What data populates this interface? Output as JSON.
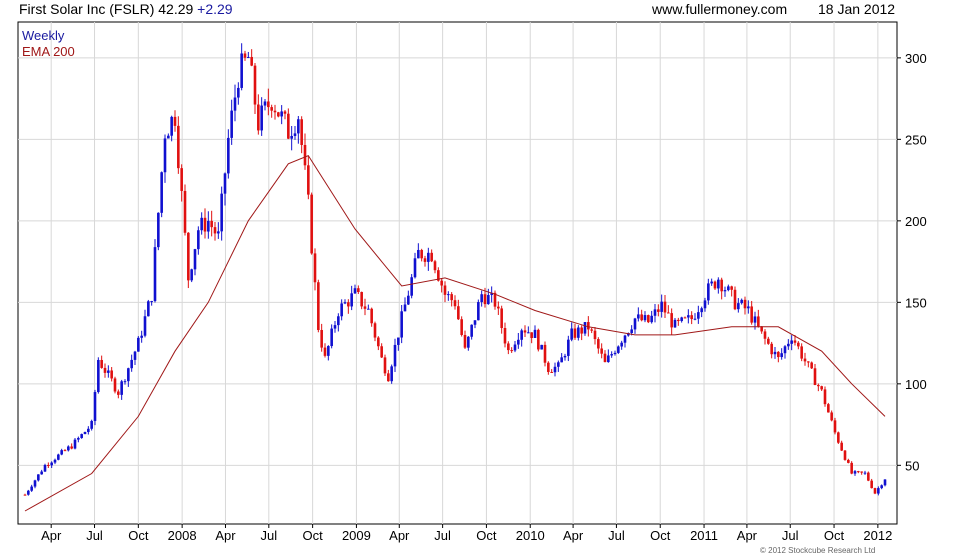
{
  "header": {
    "title": "First Solar Inc (FSLR) 42.29",
    "change": "+2.29",
    "source": "www.fullermoney.com",
    "date": "18 Jan 2012"
  },
  "copyright": "© 2012 Stockcube Research Ltd",
  "colors": {
    "up": "#1010d0",
    "down": "#e01010",
    "ema": "#a01818",
    "grid": "#d8d8d8",
    "legend_weekly": "#1a1aa0",
    "legend_ema": "#a01818"
  },
  "chart_data": {
    "type": "candlestick",
    "legend": [
      "Weekly",
      "EMA 200"
    ],
    "x_ticks": [
      "Apr",
      "Jul",
      "Oct",
      "2008",
      "Apr",
      "Jul",
      "Oct",
      "2009",
      "Apr",
      "Jul",
      "Oct",
      "2010",
      "Apr",
      "Jul",
      "Oct",
      "2011",
      "Apr",
      "Jul",
      "Oct",
      "2012"
    ],
    "y_ticks": [
      50,
      100,
      150,
      200,
      250,
      300
    ],
    "ylim": [
      14,
      322
    ],
    "grid": true,
    "y_axis_side": "right",
    "date_range": [
      "2007-02-05",
      "2012-01-16"
    ],
    "price_path": [
      [
        "2007-02-05",
        32
      ],
      [
        "2007-03-19",
        50
      ],
      [
        "2007-05-14",
        62
      ],
      [
        "2007-06-25",
        75
      ],
      [
        "2007-07-09",
        115
      ],
      [
        "2007-08-20",
        95
      ],
      [
        "2007-10-01",
        125
      ],
      [
        "2007-10-29",
        155
      ],
      [
        "2007-11-26",
        255
      ],
      [
        "2007-12-17",
        265
      ],
      [
        "2008-01-14",
        165
      ],
      [
        "2008-02-04",
        195
      ],
      [
        "2008-02-25",
        200
      ],
      [
        "2008-03-17",
        190
      ],
      [
        "2008-04-07",
        250
      ],
      [
        "2008-04-28",
        290
      ],
      [
        "2008-05-19",
        300
      ],
      [
        "2008-06-09",
        260
      ],
      [
        "2008-07-07",
        275
      ],
      [
        "2008-08-11",
        255
      ],
      [
        "2008-09-01",
        265
      ],
      [
        "2008-09-22",
        210
      ],
      [
        "2008-10-13",
        135
      ],
      [
        "2008-10-27",
        115
      ],
      [
        "2008-11-24",
        145
      ],
      [
        "2008-12-29",
        155
      ],
      [
        "2009-01-26",
        145
      ],
      [
        "2009-02-23",
        115
      ],
      [
        "2009-03-09",
        105
      ],
      [
        "2009-04-06",
        140
      ],
      [
        "2009-05-11",
        180
      ],
      [
        "2009-06-08",
        180
      ],
      [
        "2009-07-06",
        155
      ],
      [
        "2009-07-27",
        150
      ],
      [
        "2009-08-17",
        120
      ],
      [
        "2009-09-21",
        155
      ],
      [
        "2009-10-19",
        150
      ],
      [
        "2009-11-16",
        120
      ],
      [
        "2009-12-14",
        135
      ],
      [
        "2010-01-11",
        130
      ],
      [
        "2010-02-08",
        110
      ],
      [
        "2010-03-01",
        110
      ],
      [
        "2010-03-29",
        130
      ],
      [
        "2010-05-03",
        135
      ],
      [
        "2010-06-07",
        112
      ],
      [
        "2010-07-05",
        125
      ],
      [
        "2010-08-09",
        140
      ],
      [
        "2010-09-06",
        138
      ],
      [
        "2010-10-04",
        148
      ],
      [
        "2010-11-01",
        135
      ],
      [
        "2010-12-06",
        140
      ],
      [
        "2011-01-03",
        155
      ],
      [
        "2011-01-31",
        165
      ],
      [
        "2011-03-07",
        150
      ],
      [
        "2011-04-04",
        145
      ],
      [
        "2011-05-02",
        130
      ],
      [
        "2011-06-06",
        115
      ],
      [
        "2011-07-04",
        130
      ],
      [
        "2011-08-08",
        110
      ],
      [
        "2011-09-05",
        95
      ],
      [
        "2011-10-03",
        70
      ],
      [
        "2011-11-07",
        45
      ],
      [
        "2011-12-05",
        45
      ],
      [
        "2011-12-26",
        33
      ],
      [
        "2012-01-16",
        42
      ]
    ],
    "ema_path": [
      [
        "2007-02-05",
        22
      ],
      [
        "2007-06-25",
        45
      ],
      [
        "2007-10-01",
        80
      ],
      [
        "2007-12-17",
        120
      ],
      [
        "2008-02-25",
        150
      ],
      [
        "2008-05-19",
        200
      ],
      [
        "2008-08-11",
        235
      ],
      [
        "2008-09-22",
        240
      ],
      [
        "2008-12-29",
        195
      ],
      [
        "2009-04-06",
        160
      ],
      [
        "2009-07-06",
        165
      ],
      [
        "2009-10-19",
        155
      ],
      [
        "2010-01-11",
        145
      ],
      [
        "2010-05-03",
        135
      ],
      [
        "2010-08-09",
        130
      ],
      [
        "2010-11-01",
        130
      ],
      [
        "2011-02-28",
        135
      ],
      [
        "2011-06-06",
        135
      ],
      [
        "2011-09-05",
        120
      ],
      [
        "2011-11-07",
        100
      ],
      [
        "2012-01-16",
        80
      ]
    ]
  }
}
